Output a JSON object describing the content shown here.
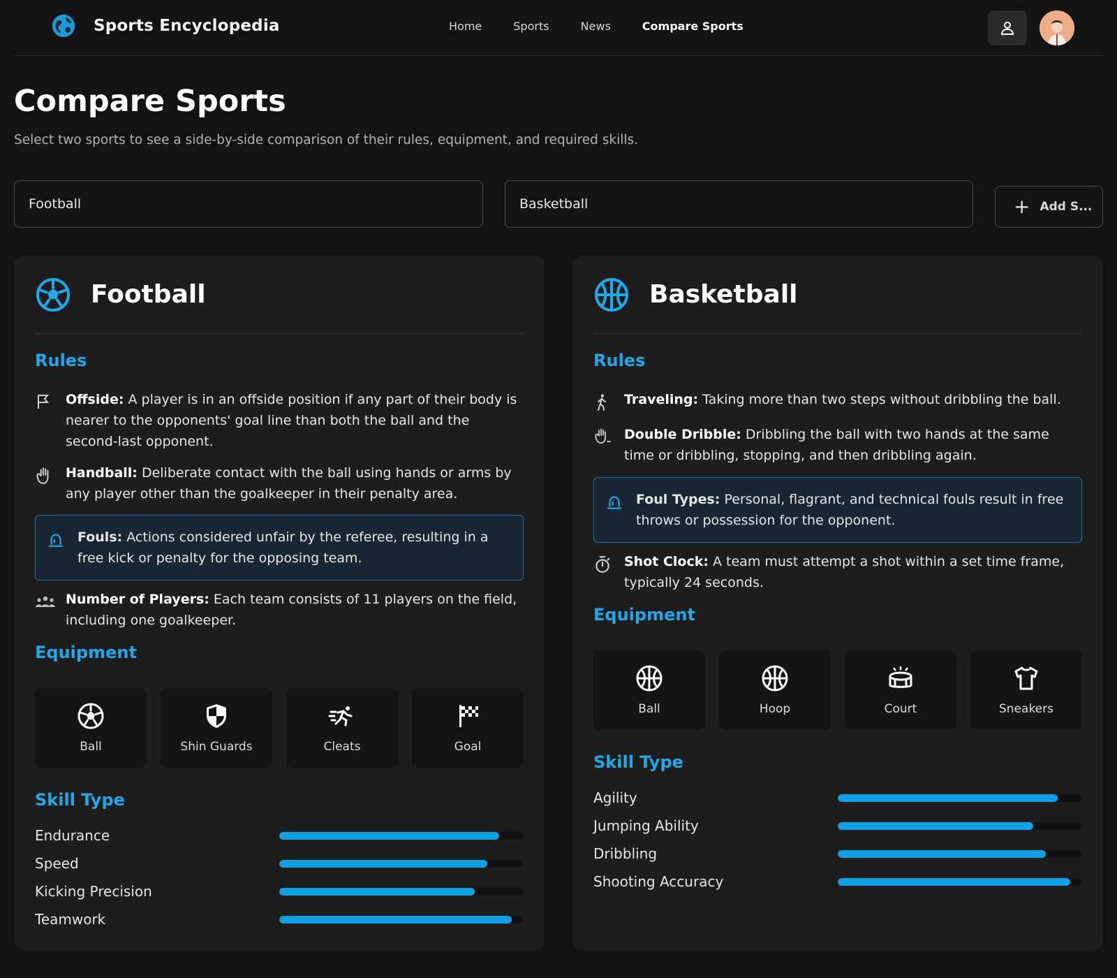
{
  "header": {
    "brand": "Sports Encyclopedia",
    "nav": [
      {
        "label": "Home"
      },
      {
        "label": "Sports"
      },
      {
        "label": "News"
      },
      {
        "label": "Compare Sports"
      }
    ]
  },
  "page": {
    "title": "Compare Sports",
    "subtitle": "Select two sports to see a side-by-side comparison of their rules, equipment, and required skills."
  },
  "selectors": {
    "first": "Football",
    "second": "Basketball",
    "add_label": "Add S..."
  },
  "colors": {
    "accent": "#22a7e8",
    "bar": "#11a0e4",
    "card": "#1d1d1d",
    "background": "#131313"
  },
  "football": {
    "name": "Football",
    "rules_title": "Rules",
    "rules": [
      {
        "icon": "flag-icon",
        "term": "Offside:",
        "text": " A player is in an offside position if any part of their body is nearer to the opponents' goal line than both the ball and the second-last opponent."
      },
      {
        "icon": "hand-icon",
        "term": "Handball:",
        "text": " Deliberate contact with the ball using hands or arms by any player other than the goalkeeper in their penalty area."
      },
      {
        "icon": "siren-icon",
        "term": "Fouls:",
        "text": " Actions considered unfair by the referee, resulting in a free kick or penalty for the opposing team."
      },
      {
        "icon": "team-icon",
        "term": "Number of Players:",
        "text": " Each team consists of 11 players on the field, including one goalkeeper."
      }
    ],
    "equipment_title": "Equipment",
    "equipment": [
      {
        "icon": "soccer-ball-icon",
        "label": "Ball"
      },
      {
        "icon": "shield-icon",
        "label": "Shin Guards"
      },
      {
        "icon": "running-shoe-icon",
        "label": "Cleats"
      },
      {
        "icon": "checkered-flag-icon",
        "label": "Goal"
      }
    ],
    "skills_title": "Skill Type",
    "skills": [
      {
        "name": "Endurance",
        "level": 0.9
      },
      {
        "name": "Speed",
        "level": 0.85
      },
      {
        "name": "Kicking Precision",
        "level": 0.8
      },
      {
        "name": "Teamwork",
        "level": 0.95
      }
    ]
  },
  "basketball": {
    "name": "Basketball",
    "rules_title": "Rules",
    "rules": [
      {
        "icon": "walking-icon",
        "term": "Traveling:",
        "text": " Taking more than two steps without dribbling the ball."
      },
      {
        "icon": "dribble-hand-icon",
        "term": "Double Dribble:",
        "text": " Dribbling the ball with two hands at the same time or dribbling, stopping, and then dribbling again."
      },
      {
        "icon": "siren-icon",
        "term": "Foul Types:",
        "text": " Personal, flagrant, and technical fouls result in free throws or possession for the opponent."
      },
      {
        "icon": "stopwatch-icon",
        "term": "Shot Clock:",
        "text": " A team must attempt a shot within a set time frame, typically 24 seconds."
      }
    ],
    "equipment_title": "Equipment",
    "equipment": [
      {
        "icon": "basketball-icon",
        "label": "Ball"
      },
      {
        "icon": "hoop-icon",
        "label": "Hoop"
      },
      {
        "icon": "court-icon",
        "label": "Court"
      },
      {
        "icon": "shirt-icon",
        "label": "Sneakers"
      }
    ],
    "skills_title": "Skill Type",
    "skills": [
      {
        "name": "Agility",
        "level": 0.9
      },
      {
        "name": "Jumping Ability",
        "level": 0.8
      },
      {
        "name": "Dribbling",
        "level": 0.85
      },
      {
        "name": "Shooting Accuracy",
        "level": 0.95
      }
    ]
  }
}
